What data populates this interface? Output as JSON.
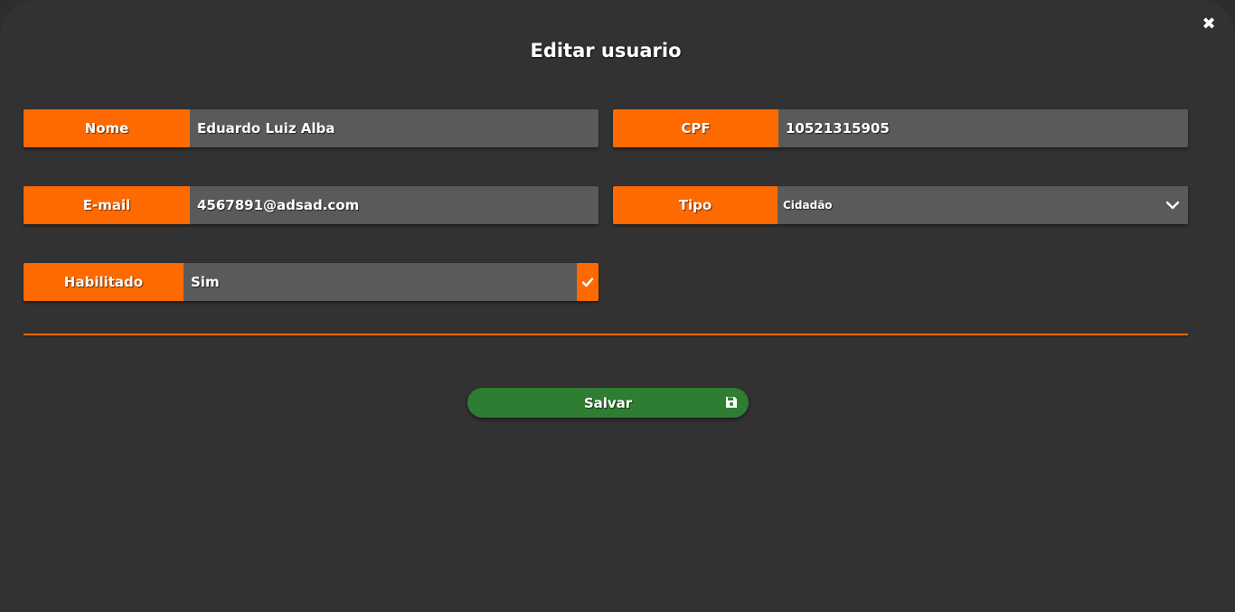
{
  "modal": {
    "title": "Editar usuario",
    "close_icon": "close-icon"
  },
  "form": {
    "nome": {
      "label": "Nome",
      "value": "Eduardo Luiz Alba"
    },
    "cpf": {
      "label": "CPF",
      "value": "10521315905"
    },
    "email": {
      "label": "E-mail",
      "value": "4567891@adsad.com"
    },
    "tipo": {
      "label": "Tipo",
      "value": "Cidadão",
      "icon": "chevron-down-icon"
    },
    "habilitado": {
      "label": "Habilitado",
      "value": "Sim",
      "icon": "checkmark-icon"
    }
  },
  "actions": {
    "save_label": "Salvar",
    "save_icon": "floppy-disk-icon"
  },
  "colors": {
    "background": "#323232",
    "accent": "#ff6a00",
    "input": "#5a5a5a",
    "save": "#2e7d32",
    "text": "#ffffff"
  }
}
